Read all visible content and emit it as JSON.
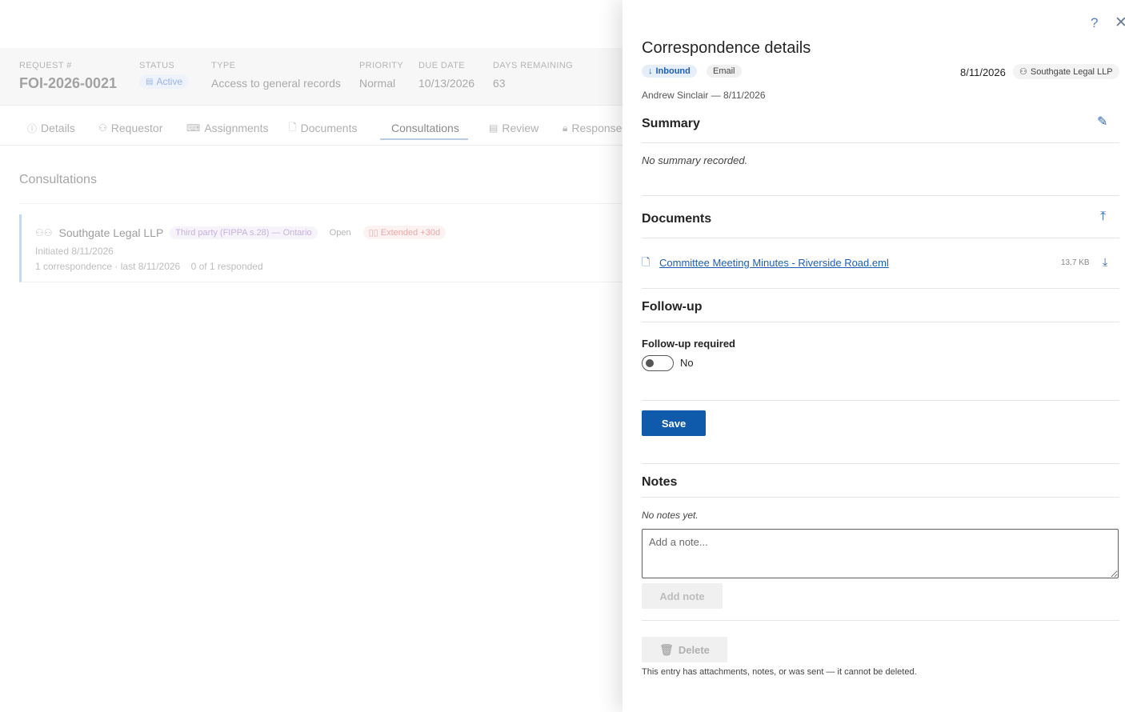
{
  "request": {
    "number_label": "REQUEST #",
    "number": "FOI-2026-0021",
    "status_label": "STATUS",
    "status": "Active",
    "type_label": "TYPE",
    "type": "Access to general records",
    "priority_label": "PRIORITY",
    "priority": "Normal",
    "due_label": "DUE DATE",
    "due": "10/13/2026",
    "days_label": "DAYS REMAINING",
    "days": "63"
  },
  "tabs": [
    {
      "label": "Details",
      "icon": "info-icon"
    },
    {
      "label": "Requestor",
      "icon": "person-icon"
    },
    {
      "label": "Assignments",
      "icon": "keyboard-icon"
    },
    {
      "label": "Documents",
      "icon": "document-icon"
    },
    {
      "label": "Consultations",
      "icon": "",
      "active": true
    },
    {
      "label": "Review",
      "icon": "review-icon"
    },
    {
      "label": "Response",
      "icon": "lock-icon"
    }
  ],
  "consultations": {
    "title": "Consultations",
    "card": {
      "name": "Southgate Legal LLP",
      "tag_party": "Third party (FIPPA s.28) — Ontario",
      "tag_status": "Open",
      "tag_extended": "Extended +30d",
      "initiated": "Initiated 8/11/2026",
      "correspondence": "1 correspondence · last 8/11/2026",
      "responded": "0 of 1 responded"
    }
  },
  "panel": {
    "help": "?",
    "close": "✕",
    "title": "Correspondence details",
    "direction": "Inbound",
    "channel": "Email",
    "date": "8/11/2026",
    "organization": "Southgate Legal LLP",
    "byline": "Andrew Sinclair — 8/11/2026",
    "summary": {
      "title": "Summary",
      "empty": "No summary recorded."
    },
    "documents": {
      "title": "Documents",
      "file_name": "Committee Meeting Minutes - Riverside Road.eml",
      "file_size": "13.7 KB"
    },
    "followup": {
      "title": "Follow-up",
      "label": "Follow-up required",
      "value": "No",
      "on": false
    },
    "save_label": "Save",
    "notes": {
      "title": "Notes",
      "empty": "No notes yet.",
      "placeholder": "Add a note...",
      "add_label": "Add note"
    },
    "delete_label": "Delete",
    "delete_note": "This entry has attachments, notes, or was sent — it cannot be deleted."
  },
  "colors": {
    "primary": "#0f5aab",
    "link": "#1e5fb5",
    "inbound_bg": "#e6eef9"
  }
}
